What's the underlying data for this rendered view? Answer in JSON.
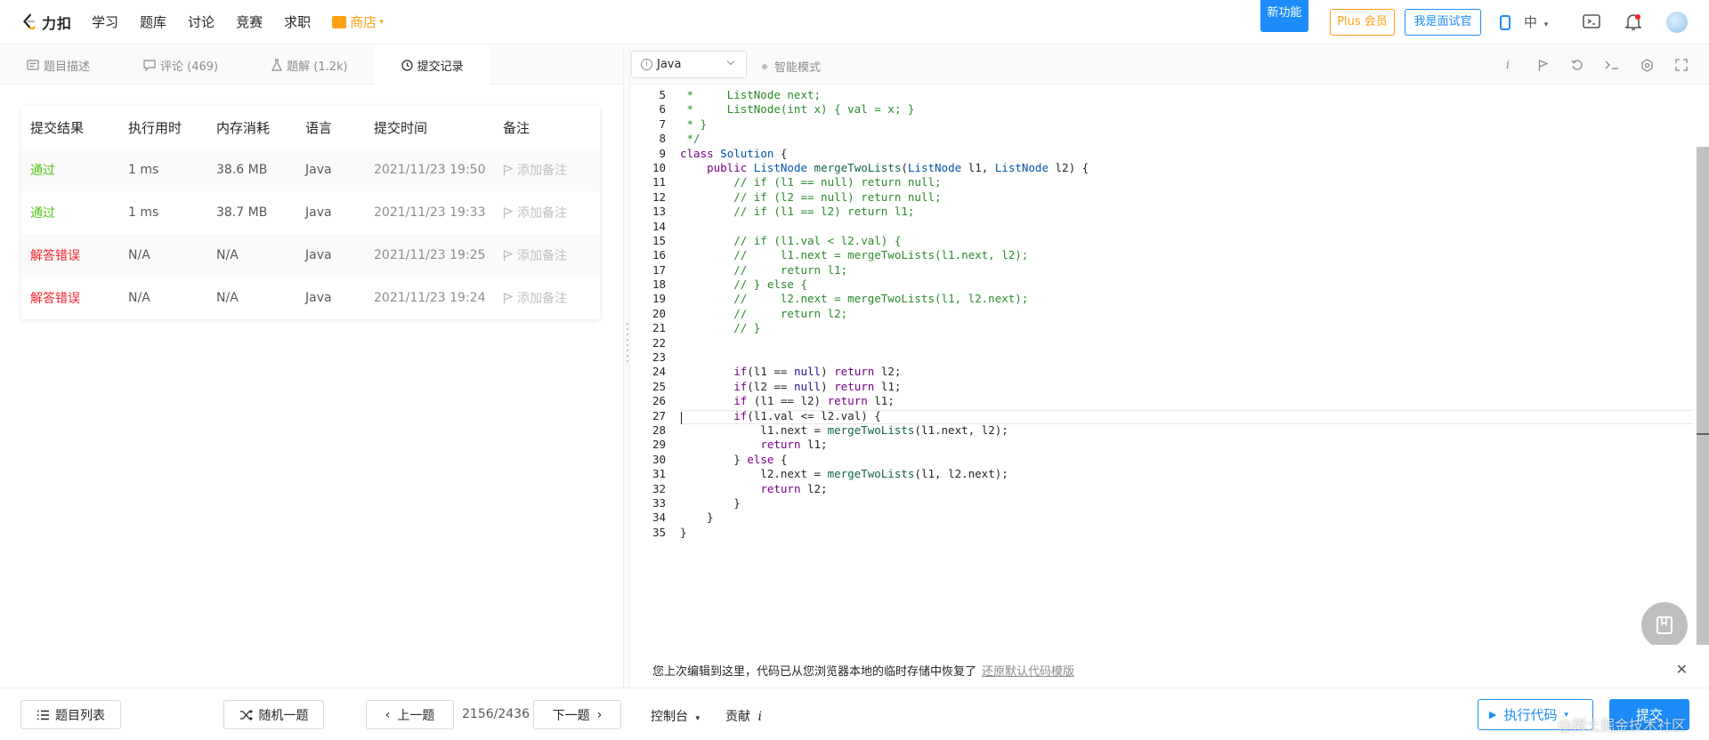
{
  "topnav": {
    "brand": "力扣",
    "items": [
      "学习",
      "题库",
      "讨论",
      "竞赛",
      "求职"
    ],
    "shop": "商店",
    "new_feature": "新功能",
    "plus": "Plus 会员",
    "interviewer": "我是面试官",
    "lang": "中"
  },
  "tabs": [
    {
      "label": "题目描述"
    },
    {
      "label": "评论 (469)"
    },
    {
      "label": "题解 (1.2k)"
    },
    {
      "label": "提交记录"
    }
  ],
  "submissions": {
    "headers": [
      "提交结果",
      "执行用时",
      "内存消耗",
      "语言",
      "提交时间",
      "备注"
    ],
    "rows": [
      {
        "result": "通过",
        "status": "pass",
        "time": "1 ms",
        "memory": "38.6 MB",
        "lang": "Java",
        "date": "2021/11/23 19:50",
        "note": "添加备注"
      },
      {
        "result": "通过",
        "status": "pass",
        "time": "1 ms",
        "memory": "38.7 MB",
        "lang": "Java",
        "date": "2021/11/23 19:33",
        "note": "添加备注"
      },
      {
        "result": "解答错误",
        "status": "fail",
        "time": "N/A",
        "memory": "N/A",
        "lang": "Java",
        "date": "2021/11/23 19:25",
        "note": "添加备注"
      },
      {
        "result": "解答错误",
        "status": "fail",
        "time": "N/A",
        "memory": "N/A",
        "lang": "Java",
        "date": "2021/11/23 19:24",
        "note": "添加备注"
      }
    ]
  },
  "editor": {
    "language": "Java",
    "smart_mode": "智能模式",
    "line_start": 5,
    "lines": [
      " *     ListNode next;",
      " *     ListNode(int x) { val = x; }",
      " * }",
      " */",
      "class Solution {",
      "    public ListNode mergeTwoLists(ListNode l1, ListNode l2) {",
      "        // if (l1 == null) return null;",
      "        // if (l2 == null) return null;",
      "        // if (l1 == l2) return l1;",
      "",
      "        // if (l1.val < l2.val) {",
      "        //     l1.next = mergeTwoLists(l1.next, l2);",
      "        //     return l1;",
      "        // } else {",
      "        //     l2.next = mergeTwoLists(l1, l2.next);",
      "        //     return l2;",
      "        // }",
      "",
      "",
      "        if(l1 == null) return l2;",
      "        if(l2 == null) return l1;",
      "        if (l1 == l2) return l1;",
      "        if(l1.val <= l2.val) {",
      "            l1.next = mergeTwoLists(l1.next, l2);",
      "            return l1;",
      "        } else {",
      "            l2.next = mergeTwoLists(l1, l2.next);",
      "            return l2;",
      "        }",
      "    }",
      "}"
    ]
  },
  "restore": {
    "message": "您上次编辑到这里，代码已从您浏览器本地的临时存储中恢复了",
    "link": "还原默认代码模版"
  },
  "bottom": {
    "problem_list": "题目列表",
    "random": "随机一题",
    "prev": "上一题",
    "progress": "2156/2436",
    "next": "下一题",
    "console": "控制台",
    "contribute": "贡献",
    "run": "执行代码",
    "submit": "提交",
    "watermark": "@稀土掘金技术社区"
  }
}
